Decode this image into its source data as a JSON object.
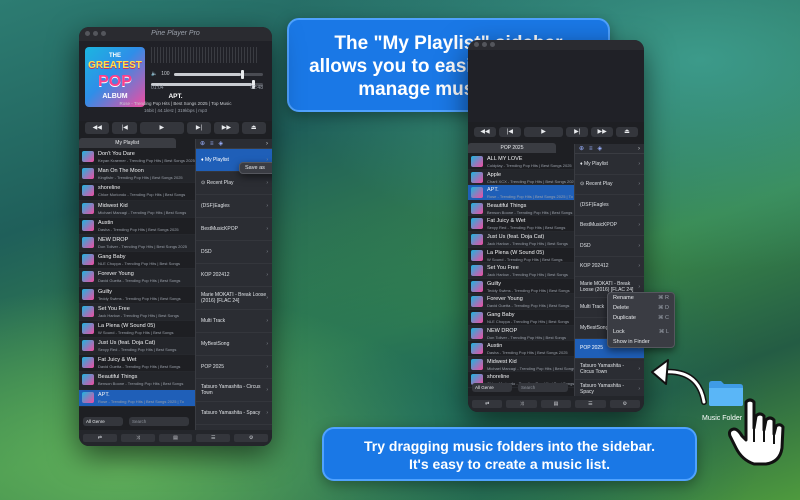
{
  "callouts": {
    "top": [
      "The \"My Playlist\" sidebar",
      "allows you to easily create and",
      "manage music lists."
    ],
    "bottom": [
      "Try dragging music folders into the sidebar.",
      "It's easy to create a music list."
    ]
  },
  "app": {
    "title": "Pine Player Pro"
  },
  "now_playing": {
    "album_art": {
      "line1": "THE",
      "line2": "GREATEST",
      "line3": "POP",
      "line4": "ALBUM"
    },
    "volume": "100",
    "volume_fraction": 0.75,
    "position_fraction": 0.9,
    "elapsed": "01:04",
    "remaining": "02:48",
    "title": "APT.",
    "subtitle": "Rose - Trending Pop Hits | Best Songs 2025 | Top Music",
    "meta": "16bit | 44.1kHz | 319kbps | mp3"
  },
  "controls": [
    "◀◀",
    "|◀",
    "▶",
    "▶|",
    "▶▶",
    "⏏"
  ],
  "left": {
    "tab_label": "My Playlist",
    "tracks": [
      {
        "title": "Don't You Dare",
        "artist": "Keyan Kraemer - Trending Pop Hits | Best Songs 2025"
      },
      {
        "title": "Man On The Moon",
        "artist": "Kingfishr - Trending Pop Hits | Best Songs 2025"
      },
      {
        "title": "shoreline",
        "artist": "Chloe Moriondo - Trending Pop Hits | Best Songs"
      },
      {
        "title": "Midwest Kid",
        "artist": "Michael Marcagi - Trending Pop Hits | Best Songs"
      },
      {
        "title": "Austin",
        "artist": "Dasha - Trending Pop Hits | Best Songs 2025"
      },
      {
        "title": "NEW DROP",
        "artist": "Don Toliver - Trending Pop Hits | Best Songs 2025"
      },
      {
        "title": "Gang Baby",
        "artist": "NLE Choppa - Trending Pop Hits | Best Songs"
      },
      {
        "title": "Forever Young",
        "artist": "David Guetta - Trending Pop Hits | Best Songs"
      },
      {
        "title": "Guilty",
        "artist": "Teddy Swims - Trending Pop Hits | Best Songs"
      },
      {
        "title": "Set You Free",
        "artist": "Jack Harlow - Trending Pop Hits | Best Songs"
      },
      {
        "title": "La Plena (W Sound 05)",
        "artist": "W Sound - Trending Pop Hits | Best Songs"
      },
      {
        "title": "Just Us (feat. Doja Cat)",
        "artist": "Sexyy Red - Trending Pop Hits | Best Songs"
      },
      {
        "title": "Fat Juicy & Wet",
        "artist": "David Guetta - Trending Pop Hits | Best Songs"
      },
      {
        "title": "Beautiful Things",
        "artist": "Benson Boone - Trending Pop Hits | Best Songs"
      },
      {
        "title": "APT.",
        "artist": "Rose - Trending Pop Hits | Best Songs 2025 | To"
      }
    ],
    "sidebar": [
      {
        "label": "♦ My Playlist",
        "selected": true
      },
      {
        "label": "⊙ Recent Play"
      },
      {
        "label": "(DSF)Eagles"
      },
      {
        "label": "BestMusicKPOP"
      },
      {
        "label": "DSD"
      },
      {
        "label": "KOP 202412"
      },
      {
        "label": "Marie MOKATI - Break Loose (2016) [FLAC 24]"
      },
      {
        "label": "Multi Track"
      },
      {
        "label": "MyBestSong"
      },
      {
        "label": "POP 2025"
      },
      {
        "label": "Tatsuro Yamashita - Circus Town"
      },
      {
        "label": "Tatsuro Yamashita - Spacy"
      }
    ],
    "save_as_menu": {
      "label": "Save as",
      "shortcut": "⌘ C"
    },
    "genre": "All Genre",
    "search_placeholder": "Search"
  },
  "right": {
    "tab_label": "POP 2025",
    "tracks": [
      {
        "title": "ALL MY LOVE",
        "artist": "Coldplay - Trending Pop Hits | Best Songs 2025"
      },
      {
        "title": "Apple",
        "artist": "Charli XCX - Trending Pop Hits | Best Songs 2025"
      },
      {
        "title": "APT.",
        "artist": "Rose - Trending Pop Hits | Best Songs 2025 | To"
      },
      {
        "title": "Beautiful Things",
        "artist": "Benson Boone - Trending Pop Hits | Best Songs"
      },
      {
        "title": "Fat Juicy & Wet",
        "artist": "Sexyy Red - Trending Pop Hits | Best Songs"
      },
      {
        "title": "Just Us (feat. Doja Cat)",
        "artist": "Jack Harlow - Trending Pop Hits | Best Songs"
      },
      {
        "title": "La Plena (W Sound 05)",
        "artist": "W Sound - Trending Pop Hits | Best Songs"
      },
      {
        "title": "Set You Free",
        "artist": "Jack Harlow - Trending Pop Hits | Best Songs"
      },
      {
        "title": "Guilty",
        "artist": "Teddy Swims - Trending Pop Hits | Best Songs"
      },
      {
        "title": "Forever Young",
        "artist": "David Guetta - Trending Pop Hits | Best Songs"
      },
      {
        "title": "Gang Baby",
        "artist": "NLE Choppa - Trending Pop Hits | Best Songs"
      },
      {
        "title": "NEW DROP",
        "artist": "Don Toliver - Trending Pop Hits | Best Songs"
      },
      {
        "title": "Austin",
        "artist": "Dasha - Trending Pop Hits | Best Songs 2025"
      },
      {
        "title": "Midwest Kid",
        "artist": "Michael Marcagi - Trending Pop Hits | Best Songs"
      },
      {
        "title": "shoreline",
        "artist": "Chloe Moriondo - Trending Pop Hits | Best Songs"
      }
    ],
    "sidebar": [
      {
        "label": "♦ My Playlist"
      },
      {
        "label": "⊙ Recent Play"
      },
      {
        "label": "(DSF)Eagles"
      },
      {
        "label": "BestMusicKPOP"
      },
      {
        "label": "DSD"
      },
      {
        "label": "KOP 202412"
      },
      {
        "label": "Marie MOKATI - Break Loose (2016) [FLAC 24]"
      },
      {
        "label": "Multi Track"
      },
      {
        "label": "MyBestSong"
      },
      {
        "label": "POP 2025",
        "selected": true
      },
      {
        "label": "Tatsuro Yamashita - Circus Town"
      },
      {
        "label": "Tatsuro Yamashita - Spacy"
      }
    ],
    "context_menu": [
      {
        "label": "Rename",
        "shortcut": "⌘ R"
      },
      {
        "label": "Delete",
        "shortcut": "⌘ D"
      },
      {
        "label": "Duplicate",
        "shortcut": "⌘ C"
      },
      {
        "label": "Lock",
        "shortcut": "⌘ L"
      },
      {
        "label": "Show in Finder",
        "shortcut": ""
      }
    ],
    "genre": "All Genre",
    "search_placeholder": "Search"
  },
  "folder": {
    "label": "Music Folder"
  },
  "colors": {
    "accent": "#1a78e6",
    "selection": "#1f5fb8"
  }
}
